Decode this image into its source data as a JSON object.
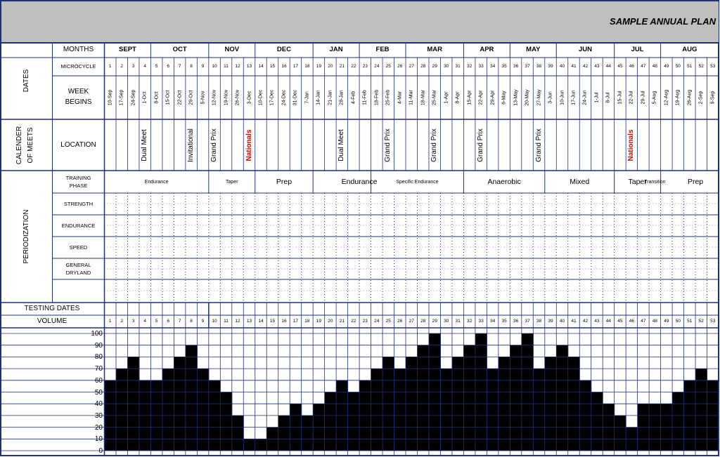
{
  "title": "SAMPLE ANNUAL PLAN",
  "section_labels": {
    "dates": "DATES",
    "meets": [
      "CALENDER",
      "OF MEETS"
    ],
    "periodization": "PERIODIZATION"
  },
  "row_labels": {
    "months": "MONTHS",
    "microcycle": "MICROCYCLE",
    "week_begins": [
      "WEEK",
      "BEGINS"
    ],
    "location": "LOCATION",
    "training_phase": [
      "TRAINING",
      "PHASE"
    ],
    "strength": "STRENGTH",
    "endurance": "ENDURANCE",
    "speed": "SPEED",
    "general_dryland": [
      "GENERAL",
      "DRYLAND"
    ],
    "testing_dates": "TESTING DATES",
    "volume": "VOLUME"
  },
  "months": [
    {
      "label": "SEPT",
      "weeks": 4
    },
    {
      "label": "OCT",
      "weeks": 5
    },
    {
      "label": "NOV",
      "weeks": 4
    },
    {
      "label": "DEC",
      "weeks": 5
    },
    {
      "label": "JAN",
      "weeks": 4
    },
    {
      "label": "FEB",
      "weeks": 4
    },
    {
      "label": "MAR",
      "weeks": 5
    },
    {
      "label": "APR",
      "weeks": 4
    },
    {
      "label": "MAY",
      "weeks": 4
    },
    {
      "label": "JUN",
      "weeks": 5
    },
    {
      "label": "JUL",
      "weeks": 4
    },
    {
      "label": "AUG",
      "weeks": 5
    }
  ],
  "microcycles": [
    "1",
    "2",
    "3",
    "4",
    "5",
    "6",
    "7",
    "8",
    "9",
    "10",
    "11",
    "12",
    "13",
    "14",
    "15",
    "16",
    "17",
    "18",
    "19",
    "20",
    "21",
    "22",
    "23",
    "24",
    "25",
    "26",
    "27",
    "28",
    "29",
    "30",
    "31",
    "32",
    "33",
    "34",
    "35",
    "36",
    "37",
    "38",
    "39",
    "40",
    "41",
    "42",
    "43",
    "44",
    "45",
    "46",
    "47",
    "48",
    "49",
    "50",
    "51",
    "52",
    "53"
  ],
  "week_begins": [
    "10-Sep",
    "17-Sep",
    "24-Sep",
    "1-Oct",
    "8-Oct",
    "15-Oct",
    "22-Oct",
    "29-Oct",
    "5-Nov",
    "12-Nov",
    "19-Nov",
    "26-Nov",
    "3-Dec",
    "10-Dec",
    "17-Dec",
    "24-Dec",
    "31-Dec",
    "7-Jan",
    "14-Jan",
    "21-Jan",
    "28-Jan",
    "4-Feb",
    "11-Feb",
    "18-Feb",
    "25-Feb",
    "4-Mar",
    "11-Mar",
    "18-Mar",
    "25-Mar",
    "1-Apr",
    "8-Apr",
    "15-Apr",
    "22-Apr",
    "29-Apr",
    "6-May",
    "13-May",
    "20-May",
    "27-May",
    "3-Jun",
    "10-Jun",
    "17-Jun",
    "24-Jun",
    "1-Jul",
    "8-Jul",
    "15-Jul",
    "22-Jul",
    "29-Jul",
    "5-Aug",
    "12-Aug",
    "19-Aug",
    "26-Aug",
    "2-Sep",
    "9-Sep"
  ],
  "meets": [
    {
      "week": 4,
      "label": "Dual Meet",
      "highlight": false
    },
    {
      "week": 8,
      "label": "Invitational",
      "highlight": false
    },
    {
      "week": 10,
      "label": "Grand Prix",
      "highlight": false
    },
    {
      "week": 13,
      "label": "Nationals",
      "highlight": true
    },
    {
      "week": 21,
      "label": "Dual Meet",
      "highlight": false
    },
    {
      "week": 25,
      "label": "Grand Prix",
      "highlight": false
    },
    {
      "week": 29,
      "label": "Grand Prix",
      "highlight": false
    },
    {
      "week": 33,
      "label": "Grand Prix",
      "highlight": false
    },
    {
      "week": 38,
      "label": "Grand Prix",
      "highlight": false
    },
    {
      "week": 46,
      "label": "Nationals",
      "highlight": true
    }
  ],
  "phases": [
    {
      "label": "Endurance",
      "start": 1,
      "end": 9,
      "size": "small"
    },
    {
      "label": "Taper",
      "start": 10,
      "end": 13,
      "size": "small"
    },
    {
      "label": "Prep",
      "start": 14,
      "end": 18,
      "size": "large"
    },
    {
      "label": "Endurance",
      "start": 19,
      "end": 26,
      "size": "large"
    },
    {
      "label": "Specific Endurance",
      "start": 24,
      "end": 31,
      "size": "small"
    },
    {
      "label": "Anaerobic",
      "start": 32,
      "end": 38,
      "size": "large"
    },
    {
      "label": "Mixed",
      "start": 39,
      "end": 44,
      "size": "large"
    },
    {
      "label": "Taper",
      "start": 45,
      "end": 48,
      "size": "large"
    },
    {
      "label": "Transition",
      "start": 47,
      "end": 49,
      "size": "small"
    },
    {
      "label": "Prep",
      "start": 50,
      "end": 53,
      "size": "large"
    }
  ],
  "chart_data": {
    "type": "bar",
    "title": "",
    "ylabel": "VOLUME",
    "ylim": [
      0,
      100
    ],
    "yticks": [
      "100",
      "90",
      "80",
      "70",
      "60",
      "50",
      "40",
      "30",
      "20",
      "10",
      "0"
    ],
    "categories": [
      "1",
      "2",
      "3",
      "4",
      "5",
      "6",
      "7",
      "8",
      "9",
      "10",
      "11",
      "12",
      "13",
      "14",
      "15",
      "16",
      "17",
      "18",
      "19",
      "20",
      "21",
      "22",
      "23",
      "24",
      "25",
      "26",
      "27",
      "28",
      "29",
      "30",
      "31",
      "32",
      "33",
      "34",
      "35",
      "36",
      "37",
      "38",
      "39",
      "40",
      "41",
      "42",
      "43",
      "44",
      "45",
      "46",
      "47",
      "48",
      "49",
      "50",
      "51",
      "52",
      "53"
    ],
    "values": [
      60,
      70,
      80,
      60,
      60,
      70,
      80,
      90,
      70,
      60,
      50,
      30,
      10,
      10,
      20,
      30,
      40,
      30,
      40,
      50,
      60,
      50,
      60,
      70,
      80,
      70,
      80,
      90,
      100,
      70,
      80,
      90,
      100,
      70,
      80,
      90,
      100,
      70,
      80,
      90,
      80,
      60,
      50,
      40,
      30,
      20,
      40,
      40,
      40,
      50,
      60,
      70,
      60
    ]
  },
  "colors": {
    "grid": "#1f2f7a",
    "title_band": "#bfbfbf",
    "bar_fill": "#000000",
    "highlight": "#e00000"
  }
}
